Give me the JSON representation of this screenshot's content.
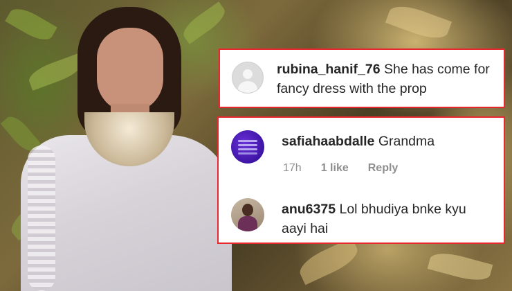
{
  "comments": [
    {
      "username": "rubina_hanif_76",
      "text": "She has come for fancy dress with the prop",
      "avatar_icon": "default-profile-icon"
    },
    {
      "username": "safiahaabdalle",
      "text": "Grandma",
      "time": "17h",
      "likes": "1 like",
      "reply_label": "Reply",
      "avatar_icon": "purple-profile-avatar"
    },
    {
      "username": "anu6375",
      "text": "Lol bhudiya bnke kyu aayi hai",
      "avatar_icon": "photo-profile-avatar"
    }
  ],
  "colors": {
    "highlight_border": "#e8262d",
    "username_text": "#262626",
    "meta_text": "#8e8e8e"
  }
}
